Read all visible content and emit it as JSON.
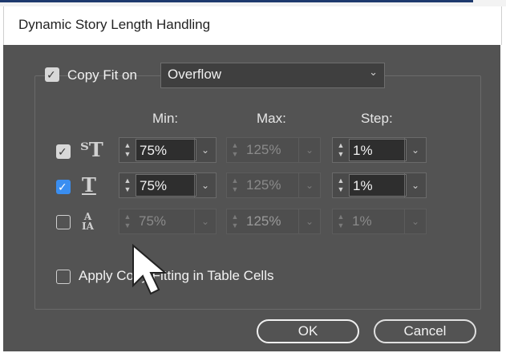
{
  "window": {
    "title": "Dynamic Story Length Handling"
  },
  "copy_fit": {
    "checkbox_label": "Copy Fit on",
    "checked": true,
    "dropdown_value": "Overflow"
  },
  "columns": {
    "min": "Min:",
    "max": "Max:",
    "step": "Step:"
  },
  "rows": [
    {
      "name": "point-size",
      "checked": true,
      "check_style": "grey",
      "min": "75%",
      "max": "125%",
      "step": "1%",
      "enabled": true
    },
    {
      "name": "horizontal-scale",
      "checked": true,
      "check_style": "blue",
      "min": "75%",
      "max": "125%",
      "step": "1%",
      "enabled": true
    },
    {
      "name": "leading",
      "checked": false,
      "check_style": "none",
      "min": "75%",
      "max": "125%",
      "step": "1%",
      "enabled": false
    }
  ],
  "table_cells": {
    "label": "Apply Copy Fitting in Table Cells",
    "checked": false
  },
  "buttons": {
    "ok": "OK",
    "cancel": "Cancel"
  },
  "icons": {
    "check": "✓",
    "chevron": "⌄",
    "spin_up": "▲",
    "spin_down": "▼"
  },
  "colors": {
    "dialog_bg": "#535353",
    "accent_check": "#3a8ef0"
  }
}
